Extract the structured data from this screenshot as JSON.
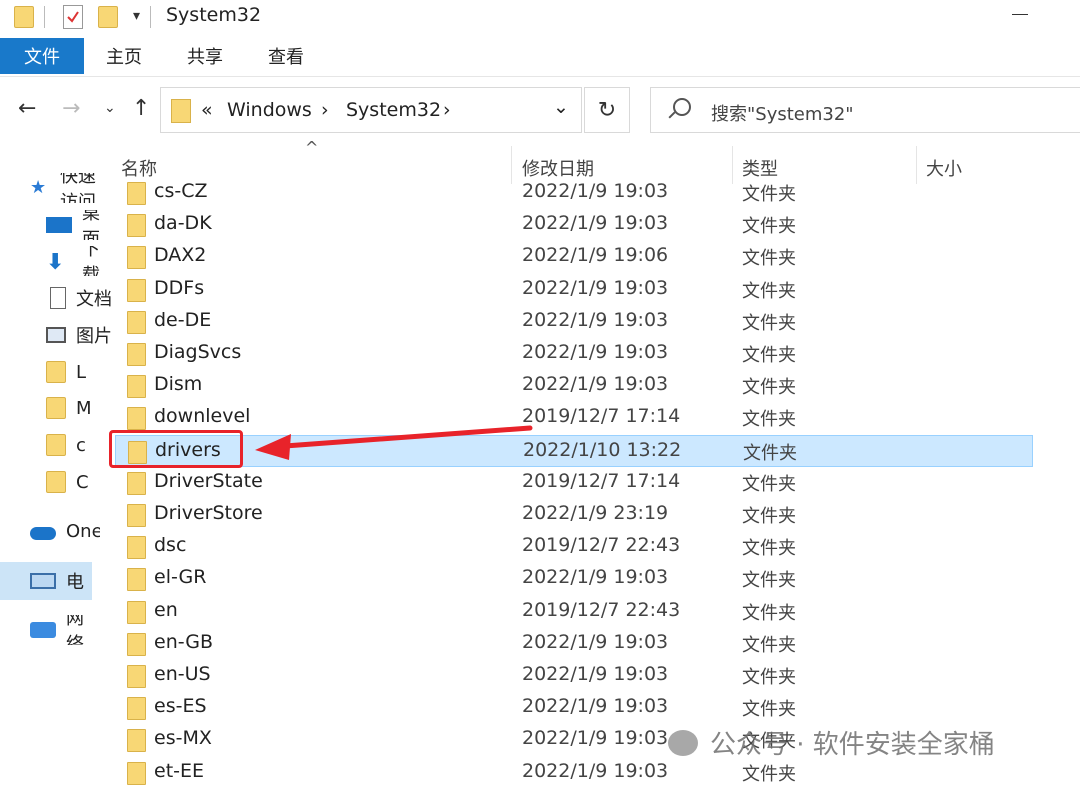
{
  "window": {
    "title": "System32"
  },
  "ribbon": {
    "tabs": [
      "文件",
      "主页",
      "共享",
      "查看"
    ]
  },
  "address_bar": {
    "crumbs": [
      "Windows",
      "System32"
    ],
    "overflow_glyph": "«",
    "separator": "›"
  },
  "search": {
    "placeholder": "搜索\"System32\""
  },
  "nav_pane": {
    "items": [
      {
        "label": "快速访问",
        "icon": "star-icon"
      },
      {
        "label": "桌面",
        "icon": "desktop-icon"
      },
      {
        "label": "下载",
        "icon": "download-icon"
      },
      {
        "label": "文档",
        "icon": "document-icon"
      },
      {
        "label": "图片",
        "icon": "picture-icon"
      },
      {
        "label": "L",
        "icon": "folder-icon"
      },
      {
        "label": "M",
        "icon": "folder-icon"
      },
      {
        "label": "c",
        "icon": "folder-icon"
      },
      {
        "label": "C",
        "icon": "folder-icon"
      },
      {
        "label": "OneDrive",
        "icon": "cloud-icon"
      },
      {
        "label": "此电脑",
        "icon": "computer-icon"
      },
      {
        "label": "网络",
        "icon": "network-icon"
      }
    ]
  },
  "columns": {
    "name": "名称",
    "date": "修改日期",
    "type": "类型",
    "size": "大小"
  },
  "files": [
    {
      "name": "cs-CZ",
      "date": "2022/1/9 19:03",
      "type": "文件夹"
    },
    {
      "name": "da-DK",
      "date": "2022/1/9 19:03",
      "type": "文件夹"
    },
    {
      "name": "DAX2",
      "date": "2022/1/9 19:06",
      "type": "文件夹"
    },
    {
      "name": "DDFs",
      "date": "2022/1/9 19:03",
      "type": "文件夹"
    },
    {
      "name": "de-DE",
      "date": "2022/1/9 19:03",
      "type": "文件夹"
    },
    {
      "name": "DiagSvcs",
      "date": "2022/1/9 19:03",
      "type": "文件夹"
    },
    {
      "name": "Dism",
      "date": "2022/1/9 19:03",
      "type": "文件夹"
    },
    {
      "name": "downlevel",
      "date": "2019/12/7 17:14",
      "type": "文件夹"
    },
    {
      "name": "drivers",
      "date": "2022/1/10 13:22",
      "type": "文件夹",
      "selected": true
    },
    {
      "name": "DriverState",
      "date": "2019/12/7 17:14",
      "type": "文件夹"
    },
    {
      "name": "DriverStore",
      "date": "2022/1/9 23:19",
      "type": "文件夹"
    },
    {
      "name": "dsc",
      "date": "2019/12/7 22:43",
      "type": "文件夹"
    },
    {
      "name": "el-GR",
      "date": "2022/1/9 19:03",
      "type": "文件夹"
    },
    {
      "name": "en",
      "date": "2019/12/7 22:43",
      "type": "文件夹"
    },
    {
      "name": "en-GB",
      "date": "2022/1/9 19:03",
      "type": "文件夹"
    },
    {
      "name": "en-US",
      "date": "2022/1/9 19:03",
      "type": "文件夹"
    },
    {
      "name": "es-ES",
      "date": "2022/1/9 19:03",
      "type": "文件夹"
    },
    {
      "name": "es-MX",
      "date": "2022/1/9 19:03",
      "type": "文件夹"
    },
    {
      "name": "et-EE",
      "date": "2022/1/9 19:03",
      "type": "文件夹"
    }
  ],
  "watermark": {
    "text": "公众号 · 软件安装全家桶"
  },
  "colors": {
    "accent": "#1979ca",
    "selection": "#cce8ff",
    "folder": "#f8d775",
    "annotation": "#e8232a"
  }
}
